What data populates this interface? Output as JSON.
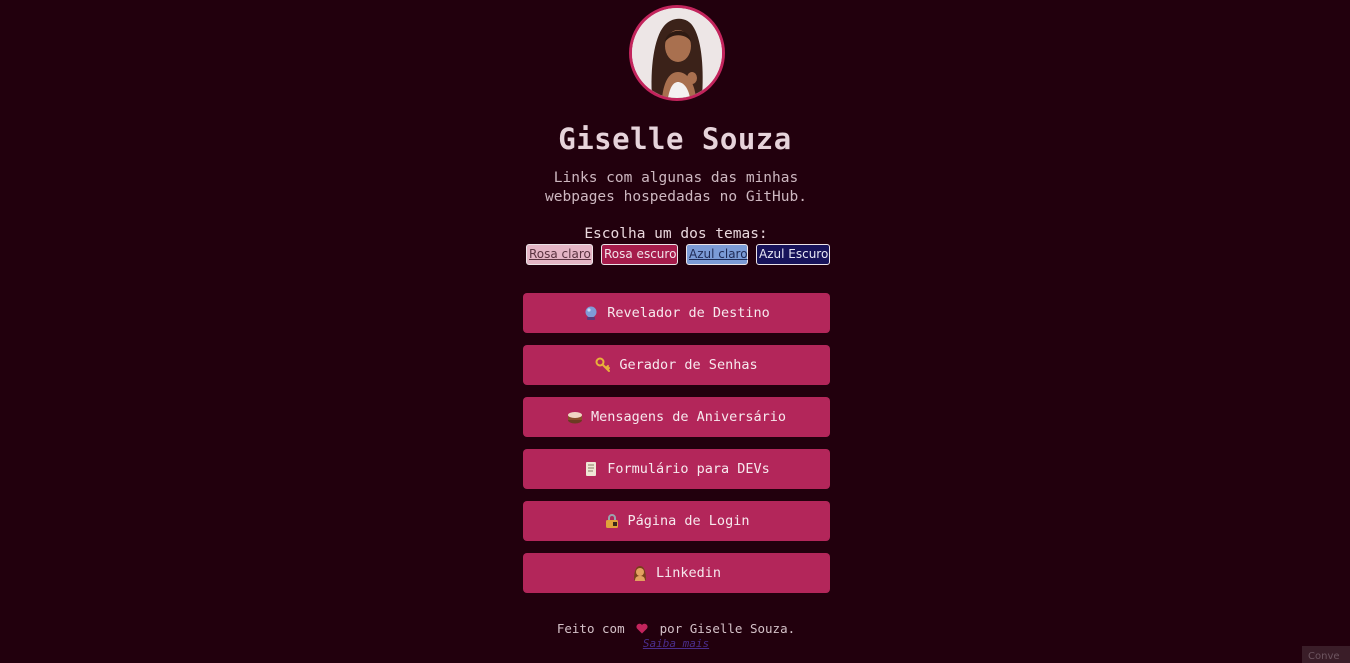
{
  "profile": {
    "name": "Giselle Souza",
    "subtitle": "Links com algunas das minhas webpages hospedadas no GitHub."
  },
  "themes": {
    "label": "Escolha um dos temas:",
    "options": [
      "Rosa claro",
      "Rosa escuro",
      "Azul claro",
      "Azul Escuro"
    ]
  },
  "links": [
    {
      "icon": "crystal-ball-icon",
      "label": "Revelador de Destino"
    },
    {
      "icon": "key-icon",
      "label": "Gerador de Senhas"
    },
    {
      "icon": "cake-icon",
      "label": "Mensagens de Aniversário"
    },
    {
      "icon": "scroll-icon",
      "label": "Formulário para DEVs"
    },
    {
      "icon": "lock-icon",
      "label": "Página de Login"
    },
    {
      "icon": "woman-icon",
      "label": "Linkedin"
    }
  ],
  "footer": {
    "prefix": "Feito com",
    "suffix": "por Giselle Souza.",
    "more": "Saiba mais",
    "corner": "Conve"
  },
  "colors": {
    "background": "#22000d",
    "accent": "#b3265a",
    "avatar_ring": "#c2245c"
  }
}
